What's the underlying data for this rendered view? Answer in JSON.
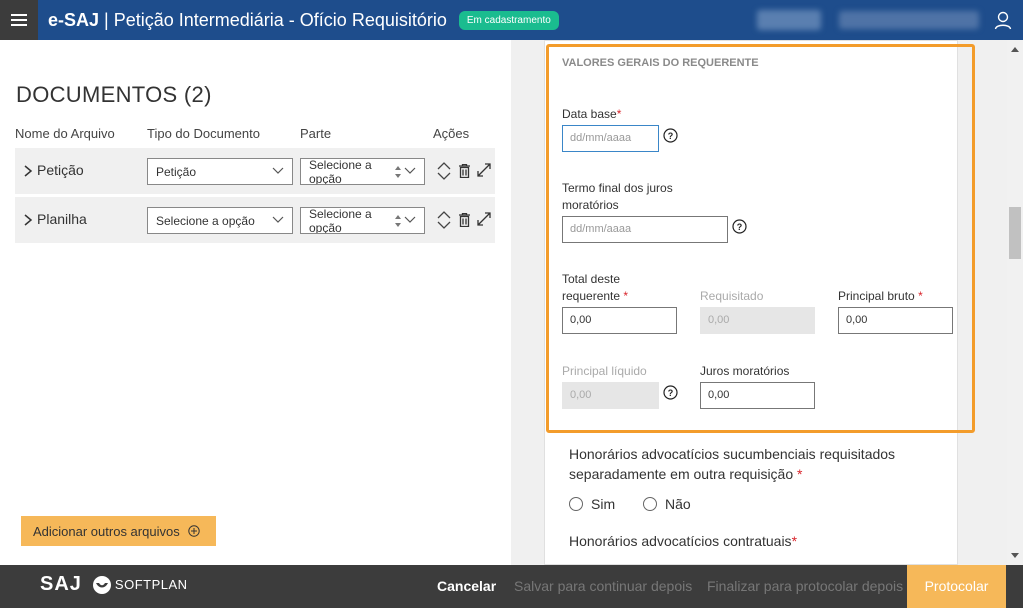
{
  "header": {
    "brand": "e-SAJ",
    "separator": "|",
    "title": "Petição Intermediária - Ofício Requisitório",
    "badge": "Em cadastramento"
  },
  "documents": {
    "title": "DOCUMENTOS (2)",
    "columns": [
      "Nome do Arquivo",
      "Tipo do Documento",
      "Parte",
      "Ações"
    ],
    "rows": [
      {
        "name": "Petição",
        "type": "Petição",
        "parte_line1": "Selecione a",
        "parte_line2": "opção"
      },
      {
        "name": "Planilha",
        "type": "Selecione a opção",
        "parte_line1": "Selecione a",
        "parte_line2": "opção"
      }
    ],
    "add_button": "Adicionar outros arquivos"
  },
  "form": {
    "section_title": "VALORES GERAIS DO REQUERENTE",
    "data_base": {
      "label": "Data base",
      "placeholder": "dd/mm/aaaa"
    },
    "termo_final": {
      "label_line1": "Termo final dos juros",
      "label_line2": "moratórios",
      "placeholder": "dd/mm/aaaa"
    },
    "total": {
      "label_line1": "Total deste",
      "label_line2": "requerente",
      "value": "0,00"
    },
    "requisitado": {
      "label": "Requisitado",
      "value": "0,00"
    },
    "principal_bruto": {
      "label": "Principal bruto",
      "value": "0,00"
    },
    "principal_liquido": {
      "label": "Principal líquido",
      "value": "0,00"
    },
    "juros": {
      "label": "Juros moratórios",
      "value": "0,00"
    },
    "required_mark": "*",
    "honorarios_sucumbenciais": {
      "line1": "Honorários advocatícios sucumbenciais requisitados",
      "line2": "separadamente em outra requisição",
      "opt_yes": "Sim",
      "opt_no": "Não"
    },
    "honorarios_contratuais": "Honorários advocatícios contratuais"
  },
  "footer": {
    "logo_saj": "SAJ",
    "logo_softplan": "SOFTPLAN",
    "cancel": "Cancelar",
    "save_later": "Salvar para continuar depois",
    "finish_later": "Finalizar para protocolar depois",
    "submit": "Protocolar"
  },
  "colors": {
    "header_blue": "#1e4d8c",
    "badge_green": "#1abc8f",
    "accent_orange": "#f6b859",
    "highlight_orange": "#f39c2b",
    "required_red": "#d9242b"
  }
}
